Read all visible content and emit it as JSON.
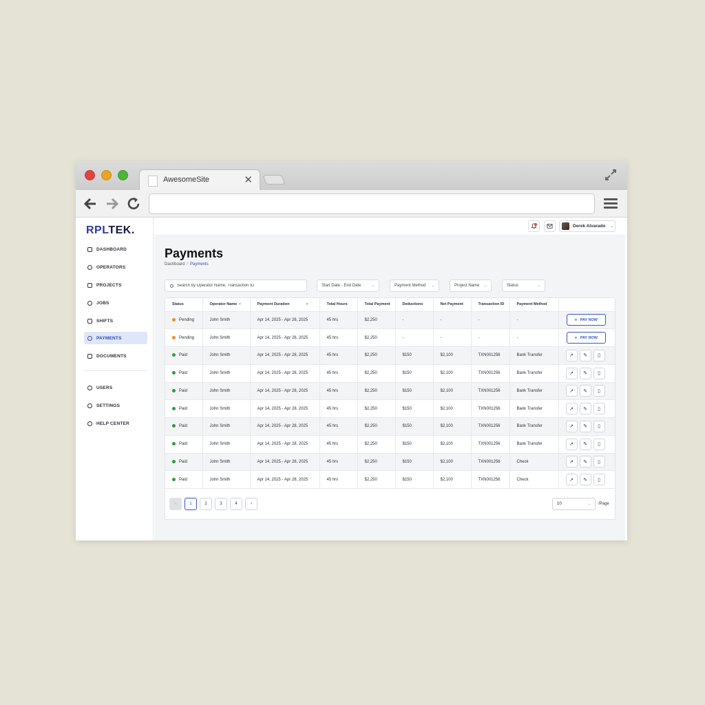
{
  "browser": {
    "tab_title": "AwesomeSite",
    "tab_close": "✕"
  },
  "app": {
    "logo_part1": "RPL",
    "logo_part2": "TEK."
  },
  "sidebar": {
    "items": [
      {
        "label": "DASHBOARD",
        "icon": "home-icon"
      },
      {
        "label": "OPERATORS",
        "icon": "operators-icon"
      },
      {
        "label": "PROJECTS",
        "icon": "projects-icon"
      },
      {
        "label": "JOBS",
        "icon": "jobs-icon"
      },
      {
        "label": "SHIFTS",
        "icon": "shifts-icon"
      },
      {
        "label": "PAYMENTS",
        "icon": "payments-icon"
      },
      {
        "label": "DOCUMENTS",
        "icon": "documents-icon"
      }
    ],
    "bottom_items": [
      {
        "label": "USERS",
        "icon": "users-icon"
      },
      {
        "label": "SETTINGS",
        "icon": "settings-icon"
      },
      {
        "label": "HELP CENTER",
        "icon": "help-icon"
      }
    ]
  },
  "topbar": {
    "user_name": "Derek Alvarado"
  },
  "page": {
    "title": "Payments",
    "breadcrumb_root": "Dashboard",
    "breadcrumb_sep": "/",
    "breadcrumb_current": "Payments"
  },
  "filters": {
    "search_placeholder": "Search by Operator Name, Transaction ID",
    "date_range": "Start Date - End Date",
    "payment_method": "Payment Method",
    "project_name": "Project Name",
    "status": "Status"
  },
  "table": {
    "headers": [
      "Status",
      "Operator Name",
      "Payment Duration",
      "Total Hours",
      "Total Payment",
      "Deductions",
      "Net Payment",
      "Transaction ID",
      "Payment Method",
      ""
    ],
    "pay_now_label": "PAY NOW",
    "rows": [
      {
        "status": "Pending",
        "operator": "John Smith",
        "duration": "Apr 14, 2025 - Apr 28, 2025",
        "hours": "45 hrs",
        "total": "$2,250",
        "deductions": "-",
        "net": "-",
        "txn": "-",
        "method": "-"
      },
      {
        "status": "Pending",
        "operator": "John Smith",
        "duration": "Apr 14, 2025 - Apr 28, 2025",
        "hours": "45 hrs",
        "total": "$2,250",
        "deductions": "-",
        "net": "-",
        "txn": "-",
        "method": "-"
      },
      {
        "status": "Paid",
        "operator": "John Smith",
        "duration": "Apr 14, 2025 - Apr 28, 2025",
        "hours": "45 hrs",
        "total": "$2,250",
        "deductions": "$150",
        "net": "$2,100",
        "txn": "TXN001256",
        "method": "Bank Transfer"
      },
      {
        "status": "Paid",
        "operator": "John Smith",
        "duration": "Apr 14, 2025 - Apr 28, 2025",
        "hours": "45 hrs",
        "total": "$2,250",
        "deductions": "$150",
        "net": "$2,100",
        "txn": "TXN001256",
        "method": "Bank Transfer"
      },
      {
        "status": "Paid",
        "operator": "John Smith",
        "duration": "Apr 14, 2025 - Apr 28, 2025",
        "hours": "45 hrs",
        "total": "$2,250",
        "deductions": "$150",
        "net": "$2,100",
        "txn": "TXN001256",
        "method": "Bank Transfer"
      },
      {
        "status": "Paid",
        "operator": "John Smith",
        "duration": "Apr 14, 2025 - Apr 28, 2025",
        "hours": "45 hrs",
        "total": "$2,250",
        "deductions": "$150",
        "net": "$2,100",
        "txn": "TXN001256",
        "method": "Bank Transfer"
      },
      {
        "status": "Paid",
        "operator": "John Smith",
        "duration": "Apr 14, 2025 - Apr 28, 2025",
        "hours": "45 hrs",
        "total": "$2,250",
        "deductions": "$150",
        "net": "$2,100",
        "txn": "TXN001256",
        "method": "Bank Transfer"
      },
      {
        "status": "Paid",
        "operator": "John Smith",
        "duration": "Apr 14, 2025 - Apr 28, 2025",
        "hours": "45 hrs",
        "total": "$2,250",
        "deductions": "$150",
        "net": "$2,100",
        "txn": "TXN001256",
        "method": "Bank Transfer"
      },
      {
        "status": "Paid",
        "operator": "John Smith",
        "duration": "Apr 14, 2025 - Apr 28, 2025",
        "hours": "45 hrs",
        "total": "$2,250",
        "deductions": "$150",
        "net": "$2,100",
        "txn": "TXN001256",
        "method": "Check"
      },
      {
        "status": "Paid",
        "operator": "John Smith",
        "duration": "Apr 14, 2025 - Apr 28, 2025",
        "hours": "45 hrs",
        "total": "$2,250",
        "deductions": "$150",
        "net": "$2,100",
        "txn": "TXN001256",
        "method": "Check"
      }
    ]
  },
  "pagination": {
    "prev": "‹",
    "pages": [
      "1",
      "2",
      "3",
      "4"
    ],
    "next": "›",
    "per_page_value": "10",
    "per_page_label": "/Page"
  },
  "colors": {
    "pending": "#f08a24",
    "paid": "#2e9a3c",
    "accent": "#3456c9"
  }
}
